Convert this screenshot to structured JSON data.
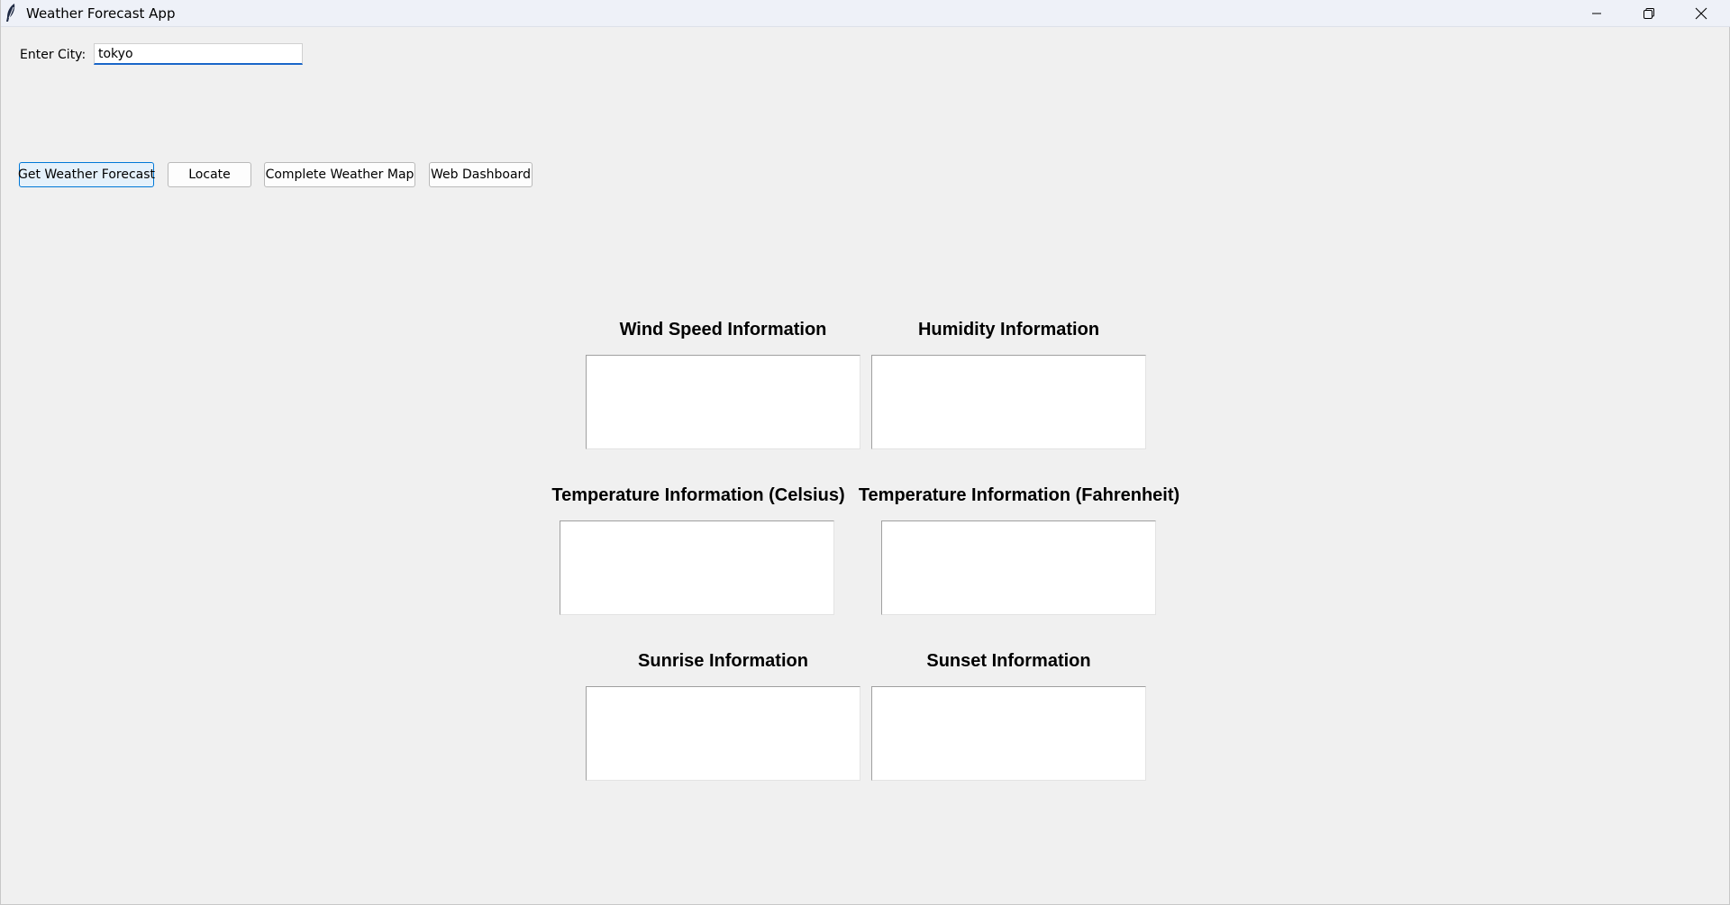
{
  "window": {
    "title": "Weather Forecast App",
    "icons": {
      "app": "feather-icon",
      "minimize": "minimize-icon",
      "maximize": "restore-icon",
      "close": "close-icon"
    }
  },
  "search": {
    "label": "Enter City:",
    "value": "tokyo",
    "focus_color": "#1a66c9"
  },
  "buttons": {
    "get_forecast": "Get Weather Forecast",
    "locate": "Locate",
    "weather_map": "Complete Weather Map",
    "web_dashboard": "Web Dashboard"
  },
  "sections": {
    "wind_speed": {
      "title": "Wind Speed Information",
      "content": ""
    },
    "humidity": {
      "title": "Humidity Information",
      "content": ""
    },
    "temp_celsius": {
      "title": "Temperature Information (Celsius)",
      "content": ""
    },
    "temp_fahrenheit": {
      "title": "Temperature Information (Fahrenheit)",
      "content": ""
    },
    "sunrise": {
      "title": "Sunrise Information",
      "content": ""
    },
    "sunset": {
      "title": "Sunset Information",
      "content": ""
    }
  }
}
